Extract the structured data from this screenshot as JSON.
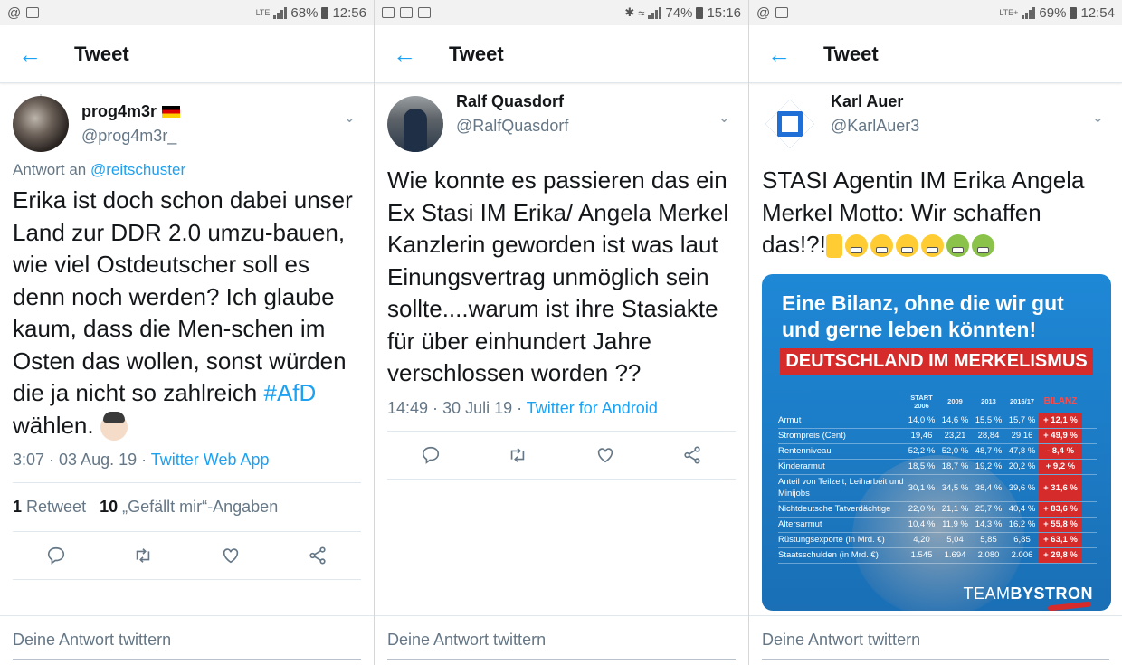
{
  "colors": {
    "accent": "#1da1f2",
    "text": "#14171a",
    "muted": "#657786",
    "banner_red": "#d52b2b"
  },
  "header": {
    "title": "Tweet",
    "back_icon": "back-arrow-icon"
  },
  "reply_placeholder": "Deine Antwort twittern",
  "panels": [
    {
      "status": {
        "left": "@",
        "net": "LTE",
        "battery": "68%",
        "time": "12:56"
      },
      "author": {
        "name": "prog4m3r",
        "handle": "@prog4m3r_"
      },
      "reply_to_prefix": "Antwort an",
      "reply_to_user": "@reitschuster",
      "text_before": "Erika ist doch schon dabei unser Land zur DDR 2.0 umzu-bauen, wie viel Ostdeutscher soll es denn noch werden? Ich glaube kaum, dass die Men-schen im Osten das wollen, sonst würden die ja nicht so zahlreich ",
      "hashtag": "#AfD",
      "text_after": " wählen.",
      "time": "3:07 · 03 Aug. 19 · ",
      "source": "Twitter Web App",
      "stats": {
        "retweets": "1",
        "retweets_label": "Retweet",
        "likes": "10",
        "likes_label": "„Gefällt mir“-Angaben"
      }
    },
    {
      "status": {
        "battery": "74%",
        "time": "15:16"
      },
      "author": {
        "name": "Ralf Quasdorf",
        "handle": "@RalfQuasdorf"
      },
      "text": "Wie konnte es passieren das ein Ex Stasi IM Erika/ Angela Merkel Kanzlerin geworden ist was laut Einungsvertrag unmöglich sein sollte....warum ist ihre Stasiakte für über einhundert Jahre verschlossen worden ??",
      "time": "14:49 · 30 Juli 19 · ",
      "source": "Twitter for Android"
    },
    {
      "status": {
        "left": "@",
        "net": "LTE+",
        "battery": "69%",
        "time": "12:54"
      },
      "author": {
        "name": "Karl Auer",
        "handle": "@KarlAuer3"
      },
      "text": "STASI Agentin IM Erika Angela Merkel Motto: Wir schaffen das!?!",
      "media": {
        "title": "Eine Bilanz, ohne die wir gut und gerne leben könnten!",
        "banner": "DEUTSCHLAND IM MERKELISMUS",
        "columns": [
          "START 2006",
          "2009",
          "2013",
          "2016/17",
          "BILANZ"
        ],
        "rows": [
          {
            "label": "Armut",
            "values": [
              "14,0 %",
              "14,6 %",
              "15,5 %",
              "15,7 %"
            ],
            "bilanz": "+ 12,1 %"
          },
          {
            "label": "Strompreis (Cent)",
            "values": [
              "19,46",
              "23,21",
              "28,84",
              "29,16"
            ],
            "bilanz": "+ 49,9 %"
          },
          {
            "label": "Rentenniveau",
            "values": [
              "52,2 %",
              "52,0 %",
              "48,7 %",
              "47,8 %"
            ],
            "bilanz": "- 8,4 %"
          },
          {
            "label": "Kinderarmut",
            "values": [
              "18,5 %",
              "18,7 %",
              "19,2 %",
              "20,2 %"
            ],
            "bilanz": "+ 9,2 %"
          },
          {
            "label": "Anteil von Teilzeit, Leiharbeit und Minijobs",
            "values": [
              "30,1 %",
              "34,5 %",
              "38,4 %",
              "39,6 %"
            ],
            "bilanz": "+ 31,6 %"
          },
          {
            "label": "Nichtdeutsche Tatverdächtige",
            "values": [
              "22,0 %",
              "21,1 %",
              "25,7 %",
              "40,4 %"
            ],
            "bilanz": "+ 83,6 %"
          },
          {
            "label": "Altersarmut",
            "values": [
              "10,4 %",
              "11,9 %",
              "14,3 %",
              "16,2 %"
            ],
            "bilanz": "+ 55,8 %"
          },
          {
            "label": "Rüstungsexporte (in Mrd. €)",
            "values": [
              "4,20",
              "5,04",
              "5,85",
              "6,85"
            ],
            "bilanz": "+ 63,1 %"
          },
          {
            "label": "Staatsschulden (in Mrd. €)",
            "values": [
              "1.545",
              "1.694",
              "2.080",
              "2.006"
            ],
            "bilanz": "+ 29,8 %"
          }
        ],
        "logo_a": "TEAM",
        "logo_b": "BYSTRON"
      }
    }
  ]
}
